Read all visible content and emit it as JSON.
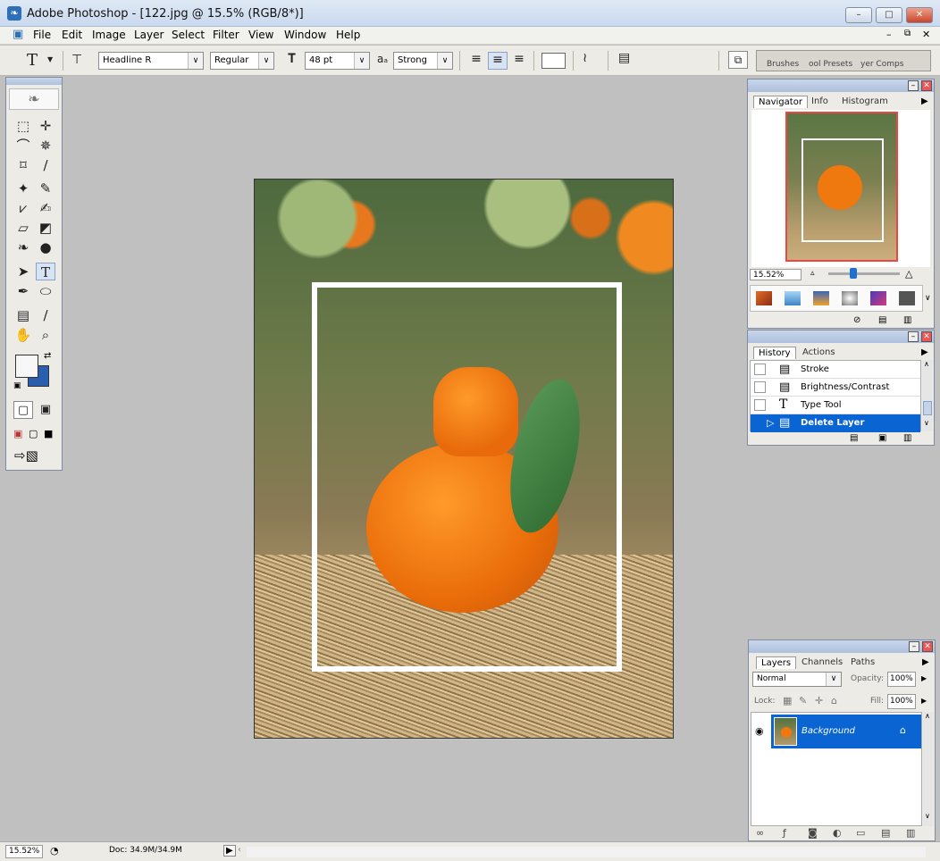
{
  "app": {
    "title": "Adobe Photoshop - [122.jpg @ 15.5% (RGB/8*)]"
  },
  "menu": [
    "File",
    "Edit",
    "Image",
    "Layer",
    "Select",
    "Filter",
    "View",
    "Window",
    "Help"
  ],
  "options": {
    "tool_glyph": "T",
    "font_family": "Headline R",
    "font_style": "Regular",
    "font_size": "48 pt",
    "aa_label": "aₐ",
    "antialias": "Strong",
    "well_tabs": [
      "Brushes",
      "ool Presets",
      "yer Comps"
    ]
  },
  "navigator": {
    "tabs": [
      "Navigator",
      "Info",
      "Histogram"
    ],
    "zoom": "15.52%"
  },
  "history": {
    "tabs": [
      "History",
      "Actions"
    ],
    "items": [
      {
        "label": "Stroke",
        "icon": "document-icon"
      },
      {
        "label": "Brightness/Contrast",
        "icon": "document-icon"
      },
      {
        "label": "Type Tool",
        "icon": "type-icon"
      },
      {
        "label": "Delete Layer",
        "icon": "document-icon",
        "selected": true
      }
    ]
  },
  "layers": {
    "tabs": [
      "Layers",
      "Channels",
      "Paths"
    ],
    "blend_mode": "Normal",
    "opacity_label": "Opacity:",
    "opacity": "100%",
    "lock_label": "Lock:",
    "fill_label": "Fill:",
    "fill": "100%",
    "items": [
      {
        "name": "Background",
        "visible": true,
        "locked": true
      }
    ]
  },
  "status": {
    "zoom": "15.52%",
    "doc": "Doc: 34.9M/34.9M"
  },
  "colors": {
    "accent": "#0a64d2",
    "canvas_bg": "#c0c0c0",
    "fruit": "#f07a10",
    "leaf": "#3b7d3a",
    "straw": "#b89a6a"
  }
}
